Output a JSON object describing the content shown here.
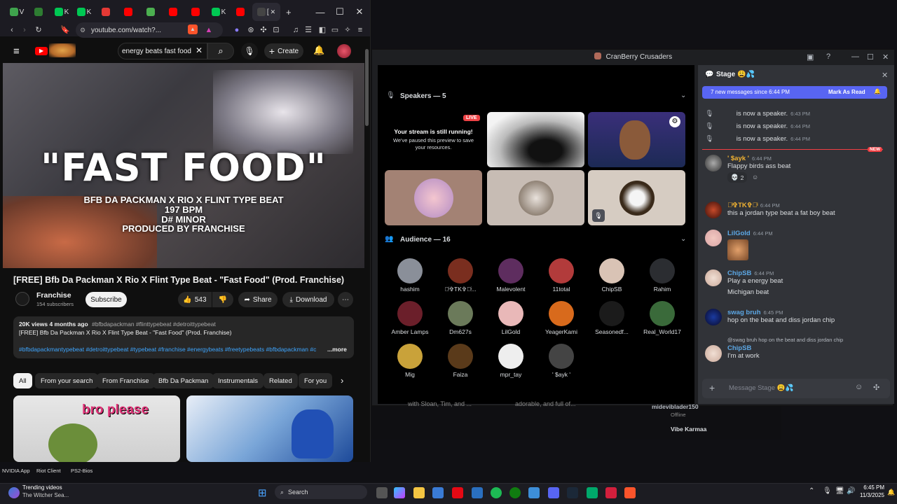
{
  "browser": {
    "tabs": [
      {
        "label": "V",
        "color": "#3fa34d"
      },
      {
        "label": "",
        "color": "#2e7d32"
      },
      {
        "label": "K",
        "color": "#00c853"
      },
      {
        "label": "K",
        "color": "#00c853"
      },
      {
        "label": "",
        "color": "#e53935"
      },
      {
        "label": "",
        "color": "#ff0000"
      },
      {
        "label": "",
        "color": "#4caf50"
      },
      {
        "label": "",
        "color": "#ff0000"
      },
      {
        "label": "",
        "color": "#ff0000"
      },
      {
        "label": "K",
        "color": "#00c853"
      },
      {
        "label": "",
        "color": "#ff0000"
      },
      {
        "label": "[",
        "color": "#444"
      }
    ],
    "active_tab_close": "✕",
    "new_tab": "+",
    "url": "youtube.com/watch?...",
    "search_query": "energy beats fast food",
    "create_label": "Create"
  },
  "video": {
    "hero_title": "\"FAST FOOD\"",
    "hero_line1": "BFB DA PACKMAN X RIO X FLINT TYPE BEAT",
    "hero_line2": "197 BPM",
    "hero_line3": "D# MINOR",
    "hero_line4": "PRODUCED BY FRANCHISE",
    "title": "[FREE] Bfb Da Packman X Rio X Flint Type Beat - \"Fast Food\" (Prod. Franchise)",
    "channel": "Franchise",
    "subscribers": "154 subscribers",
    "subscribe": "Subscribe",
    "likes": "543",
    "share": "Share",
    "download": "Download",
    "views_line": "20K views  4 months ago",
    "tags_inline": "#bfbdapackman #flinttypebeat #detroittypebeat",
    "desc_line": "[FREE] Bfb Da Packman X Rio X Flint Type Beat - \"Fast Food\" (Prod. Franchise)",
    "hashtags": "#bfbdapackmantypebeat #detroittypebeat #typebeat #franchise #energybeats #freetypebeats #bfbdapackman #c",
    "more": "...more",
    "chips": [
      "All",
      "From your search",
      "From Franchise",
      "Bfb Da Packman",
      "Instrumentals",
      "Related",
      "For you"
    ],
    "thumb1_text": "bro please"
  },
  "discord": {
    "window_title": "CranBerry Crusaders",
    "speakers_label": "Speakers — 5",
    "live_badge": "LIVE",
    "stream_running": "Your stream is still running!",
    "stream_paused": "We've paused this preview to save your resources.",
    "audience_label": "Audience — 16",
    "audience": [
      {
        "name": "hashim",
        "color": "#8a8f99"
      },
      {
        "name": "✞ͥ✞TK✞✞ͥ...",
        "color": "#7a2e1f"
      },
      {
        "name": "Malevolent",
        "color": "#5e2d5f"
      },
      {
        "name": "11total",
        "color": "#b23b3b"
      },
      {
        "name": "ChipSB",
        "color": "#d9c3b5"
      },
      {
        "name": "Rahim",
        "color": "#2b2d31"
      },
      {
        "name": "Amber Lamps",
        "color": "#6b1f2a"
      },
      {
        "name": "Dm627s",
        "color": "#6b7a5a"
      },
      {
        "name": "LilGold",
        "color": "#e9b8b8"
      },
      {
        "name": "YeagerKami",
        "color": "#d86a1c"
      },
      {
        "name": "Seasonedf...",
        "color": "#1b1b1b"
      },
      {
        "name": "Real_World17",
        "color": "#3a6a3a"
      },
      {
        "name": "Mig",
        "color": "#c9a23a"
      },
      {
        "name": "Faiza",
        "color": "#5a3a1a"
      },
      {
        "name": "mpr_tay",
        "color": "#eeeeee"
      },
      {
        "name": "' $ayk '",
        "color": "#444"
      }
    ],
    "chat": {
      "header": "Stage",
      "new_messages": "7 new messages since 6:44 PM",
      "mark_read": "Mark As Read",
      "system": [
        {
          "text": "is now a speaker.",
          "time": "6:43 PM"
        },
        {
          "text": "is now a speaker.",
          "time": "6:44 PM"
        },
        {
          "text": "is now a speaker.",
          "time": "6:44 PM"
        }
      ],
      "new_tag": "NEW",
      "messages": [
        {
          "name": "' $ayk '",
          "color": "#f0b232",
          "time": "6:44 PM",
          "text": "Flappy birds ass beat",
          "reaction_count": "2"
        },
        {
          "name": "✞ͥ✞TK✞✞ͥ",
          "color": "#f0b232",
          "time": "6:44 PM",
          "text": "this a jordan type beat a fat boy beat"
        },
        {
          "name": "LilGold",
          "color": "#5ca7e4",
          "time": "6:44 PM",
          "text": ""
        },
        {
          "name": "ChipSB",
          "color": "#5ca7e4",
          "time": "6:44 PM",
          "text": "Play a energy beat",
          "text2": "Michigan beat"
        },
        {
          "name": "swag bruh",
          "color": "#5ca7e4",
          "time": "6:45 PM",
          "text": "hop on the beat and diss jordan chip"
        },
        {
          "name": "ChipSB",
          "color": "#5ca7e4",
          "time": "",
          "text": "I'm at work",
          "reply": "@swag bruh hop on the beat and diss jordan chip"
        }
      ],
      "input_placeholder": "Message Stage"
    },
    "behind_text1": "with Sloan, Tim, and ...",
    "behind_text2": "adorable, and full of...",
    "behind_user1": "mideviblader150",
    "behind_user1_status": "Offline",
    "behind_user2": "Vibe Karmaa"
  },
  "desktop": {
    "icons": [
      "NVIDIA App",
      "Riot Client",
      "PS2-Bios"
    ]
  },
  "taskbar": {
    "weather_line1": "Trending videos",
    "weather_line2": "The Witcher Sea...",
    "search": "Search",
    "time": "6:45 PM",
    "date": "11/3/2025"
  }
}
